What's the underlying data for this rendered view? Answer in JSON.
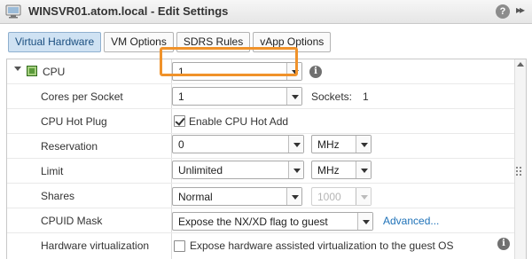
{
  "window": {
    "title": "WINSVR01.atom.local - Edit Settings",
    "help_label": "?",
    "expand_label": "▸▸"
  },
  "tabs": [
    {
      "label": "Virtual Hardware",
      "active": true
    },
    {
      "label": "VM Options",
      "active": false
    },
    {
      "label": "SDRS Rules",
      "active": false
    },
    {
      "label": "vApp Options",
      "active": false
    }
  ],
  "cpu": {
    "label": "CPU",
    "value": "1",
    "info_icon": "info-icon"
  },
  "cores_per_socket": {
    "label": "Cores per Socket",
    "value": "1",
    "sockets_label": "Sockets:",
    "sockets_value": "1"
  },
  "cpu_hot_plug": {
    "label": "CPU Hot Plug",
    "checkbox_label": "Enable CPU Hot Add",
    "checked": true,
    "highlight_color": "#f0922a"
  },
  "reservation": {
    "label": "Reservation",
    "value": "0",
    "unit": "MHz"
  },
  "limit": {
    "label": "Limit",
    "value": "Unlimited",
    "unit": "MHz"
  },
  "shares": {
    "label": "Shares",
    "value": "Normal",
    "amount": "1000"
  },
  "cpuid_mask": {
    "label": "CPUID Mask",
    "value": "Expose the NX/XD flag to guest",
    "advanced_link": "Advanced..."
  },
  "hardware_virtualization": {
    "label": "Hardware virtualization",
    "checkbox_label": "Expose hardware assisted virtualization to the guest OS",
    "checked": false
  },
  "colors": {
    "active_tab_bg": "#cfe2f3",
    "link": "#1f72b8",
    "highlight": "#f0922a"
  }
}
